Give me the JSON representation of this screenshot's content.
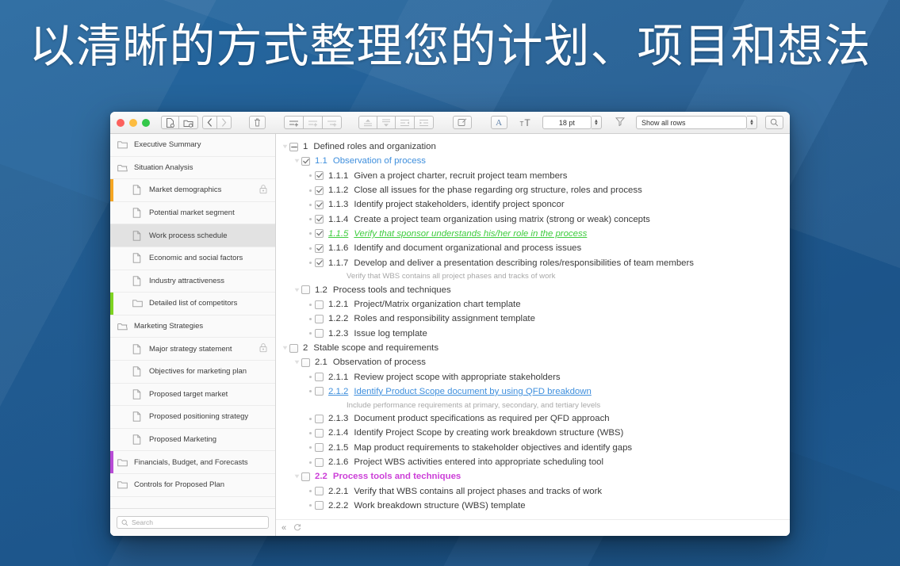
{
  "headline": "以清晰的方式整理您的计划、项目和想法",
  "colors": {
    "background": "#1f5c99",
    "accent_blue": "#3f8fdd",
    "accent_green": "#3ecc3e",
    "accent_magenta": "#cc3fd8",
    "row_orange": "#f5a623",
    "row_green": "#7ed321",
    "row_purple": "#b84bd6"
  },
  "toolbar": {
    "traffic_lights": [
      "close",
      "minimize",
      "zoom"
    ],
    "buttons": [
      {
        "name": "new-document",
        "label": ""
      },
      {
        "name": "new-folder",
        "label": ""
      },
      {
        "name": "back",
        "label": ""
      },
      {
        "name": "forward",
        "label": ""
      },
      {
        "name": "delete",
        "label": ""
      },
      {
        "name": "add-row",
        "label": ""
      },
      {
        "name": "add-row-above",
        "label": ""
      },
      {
        "name": "add-child-row",
        "label": ""
      },
      {
        "name": "move-row-up",
        "label": ""
      },
      {
        "name": "move-row-down",
        "label": ""
      },
      {
        "name": "outdent-row",
        "label": ""
      },
      {
        "name": "indent-row",
        "label": ""
      },
      {
        "name": "edit-note",
        "label": ""
      },
      {
        "name": "font-panel",
        "label": "A"
      },
      {
        "name": "text-size",
        "label": ""
      },
      {
        "name": "search",
        "label": ""
      }
    ],
    "font_size": "18 pt",
    "filter_value": "Show all rows"
  },
  "sidebar": {
    "search_placeholder": "Search",
    "items": [
      {
        "label": "Executive Summary",
        "icon": "folder-icon",
        "child": false,
        "bar": "",
        "locked": false,
        "selected": false
      },
      {
        "label": "Situation Analysis",
        "icon": "folder-open-icon",
        "child": false,
        "bar": "",
        "locked": false,
        "selected": false
      },
      {
        "label": "Market demographics",
        "icon": "document-icon",
        "child": true,
        "bar": "#f5a623",
        "locked": true,
        "selected": false
      },
      {
        "label": "Potential market segment",
        "icon": "document-icon",
        "child": true,
        "bar": "",
        "locked": false,
        "selected": false
      },
      {
        "label": "Work process schedule",
        "icon": "document-icon",
        "child": true,
        "bar": "",
        "locked": false,
        "selected": true
      },
      {
        "label": "Economic and social factors",
        "icon": "document-icon",
        "child": true,
        "bar": "",
        "locked": false,
        "selected": false
      },
      {
        "label": "Industry attractiveness",
        "icon": "document-icon",
        "child": true,
        "bar": "",
        "locked": false,
        "selected": false
      },
      {
        "label": "Detailed list of competitors",
        "icon": "folder-icon",
        "child": true,
        "bar": "#7ed321",
        "locked": false,
        "selected": false
      },
      {
        "label": "Marketing Strategies",
        "icon": "folder-open-icon",
        "child": false,
        "bar": "",
        "locked": false,
        "selected": false
      },
      {
        "label": "Major strategy statement",
        "icon": "document-icon",
        "child": true,
        "bar": "",
        "locked": true,
        "selected": false
      },
      {
        "label": "Objectives for marketing plan",
        "icon": "document-icon",
        "child": true,
        "bar": "",
        "locked": false,
        "selected": false
      },
      {
        "label": "Proposed target market",
        "icon": "document-icon",
        "child": true,
        "bar": "",
        "locked": false,
        "selected": false
      },
      {
        "label": "Proposed positioning strategy",
        "icon": "document-icon",
        "child": true,
        "bar": "",
        "locked": false,
        "selected": false
      },
      {
        "label": "Proposed Marketing",
        "icon": "document-icon",
        "child": true,
        "bar": "",
        "locked": false,
        "selected": false
      },
      {
        "label": "Financials, Budget, and Forecasts",
        "icon": "folder-icon",
        "child": false,
        "bar": "#b84bd6",
        "locked": false,
        "selected": false
      },
      {
        "label": "Controls for Proposed Plan",
        "icon": "folder-icon",
        "child": false,
        "bar": "",
        "locked": false,
        "selected": false
      }
    ]
  },
  "outline": {
    "rows": [
      {
        "num": "1",
        "text": "Defined roles and organization",
        "level": 1,
        "control": "triangle",
        "check": "mixed",
        "style": "plain"
      },
      {
        "num": "1.1",
        "text": "Observation of process",
        "level": 2,
        "control": "triangle",
        "check": "checked",
        "style": "blue"
      },
      {
        "num": "1.1.1",
        "text": "Given a project charter, recruit project team members",
        "level": 3,
        "control": "dot",
        "check": "checked",
        "style": "plain"
      },
      {
        "num": "1.1.2",
        "text": "Close all issues for the phase regarding org structure, roles and process",
        "level": 3,
        "control": "dot",
        "check": "checked",
        "style": "plain"
      },
      {
        "num": "1.1.3",
        "text": "Identify project stakeholders, identify project sponcor",
        "level": 3,
        "control": "dot",
        "check": "checked",
        "style": "plain"
      },
      {
        "num": "1.1.4",
        "text": "Create a project team organization using matrix (strong or weak) concepts",
        "level": 3,
        "control": "dot",
        "check": "checked",
        "style": "plain"
      },
      {
        "num": "1.1.5",
        "text": "Verify that sponsor understands his/her role in the process",
        "level": 3,
        "control": "dot",
        "check": "checked",
        "style": "green-italic-underline"
      },
      {
        "num": "1.1.6",
        "text": "Identify and document organizational and process issues",
        "level": 3,
        "control": "dot",
        "check": "checked",
        "style": "plain"
      },
      {
        "num": "1.1.7",
        "text": "Develop and deliver a presentation describing roles/responsibilities of team members",
        "level": 3,
        "control": "dot",
        "check": "checked",
        "style": "plain",
        "note": "Verify that WBS contains all project phases and tracks of work"
      },
      {
        "num": "1.2",
        "text": "Process tools and techniques",
        "level": 2,
        "control": "triangle",
        "check": "empty",
        "style": "plain"
      },
      {
        "num": "1.2.1",
        "text": "Project/Matrix organization chart template",
        "level": 3,
        "control": "dot",
        "check": "empty",
        "style": "plain"
      },
      {
        "num": "1.2.2",
        "text": "Roles and responsibility assignment template",
        "level": 3,
        "control": "dot",
        "check": "empty",
        "style": "plain"
      },
      {
        "num": "1.2.3",
        "text": "Issue log template",
        "level": 3,
        "control": "dot",
        "check": "empty",
        "style": "plain"
      },
      {
        "num": "2",
        "text": "Stable scope and requirements",
        "level": 1,
        "control": "triangle",
        "check": "empty",
        "style": "plain"
      },
      {
        "num": "2.1",
        "text": "Observation of process",
        "level": 2,
        "control": "triangle",
        "check": "empty",
        "style": "plain"
      },
      {
        "num": "2.1.1",
        "text": "Review project scope with appropriate stakeholders",
        "level": 3,
        "control": "dot",
        "check": "empty",
        "style": "plain"
      },
      {
        "num": "2.1.2",
        "text": "Identify Product Scope document by using QFD breakdown",
        "level": 3,
        "control": "dot",
        "check": "empty",
        "style": "blue-underline",
        "note": "Include performance requirements at primary, secondary, and tertiary levels"
      },
      {
        "num": "2.1.3",
        "text": "Document product specifications as required per QFD approach",
        "level": 3,
        "control": "dot",
        "check": "empty",
        "style": "plain"
      },
      {
        "num": "2.1.4",
        "text": "Identify Project Scope by creating work breakdown structure (WBS)",
        "level": 3,
        "control": "dot",
        "check": "empty",
        "style": "plain"
      },
      {
        "num": "2.1.5",
        "text": "Map product requirements to stakeholder objectives and identify gaps",
        "level": 3,
        "control": "dot",
        "check": "empty",
        "style": "plain"
      },
      {
        "num": "2.1.6",
        "text": "Project WBS activities entered into appropriate scheduling tool",
        "level": 3,
        "control": "dot",
        "check": "empty",
        "style": "plain"
      },
      {
        "num": "2.2",
        "text": "Process tools and techniques",
        "level": 2,
        "control": "triangle",
        "check": "empty",
        "style": "magenta-bold"
      },
      {
        "num": "2.2.1",
        "text": "Verify that WBS contains all project phases and tracks of work",
        "level": 3,
        "control": "dot",
        "check": "empty",
        "style": "plain"
      },
      {
        "num": "2.2.2",
        "text": "Work breakdown structure (WBS) template",
        "level": 3,
        "control": "dot",
        "check": "empty",
        "style": "plain"
      }
    ],
    "footer": {
      "collapse": "«",
      "sync": "sync-icon"
    }
  }
}
